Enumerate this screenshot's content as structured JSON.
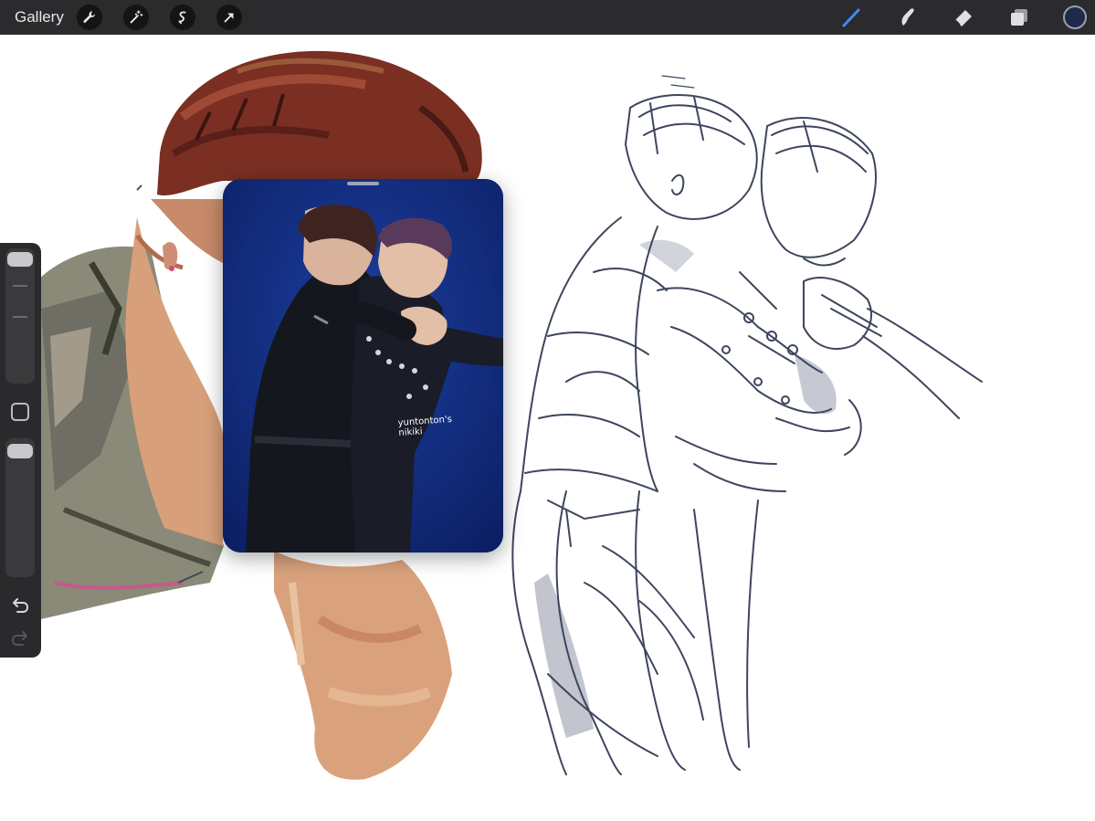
{
  "topbar": {
    "gallery_label": "Gallery",
    "left_tools": [
      {
        "name": "actions-wrench-icon"
      },
      {
        "name": "adjustments-wand-icon"
      },
      {
        "name": "selection-icon"
      },
      {
        "name": "transform-arrow-icon"
      }
    ],
    "right_tools": [
      {
        "name": "brush-icon",
        "active": true,
        "color": "#3d8bff"
      },
      {
        "name": "smudge-icon",
        "active": false
      },
      {
        "name": "eraser-icon",
        "active": false
      },
      {
        "name": "layers-icon",
        "active": false
      }
    ],
    "current_color": "#1f2a4a"
  },
  "sidebar": {
    "brush_size_level": 0.0,
    "opacity_level": 0.0
  },
  "reference": {
    "watermark": "yuntonton's\nnikiki",
    "background_color": "#102a7a"
  },
  "colors": {
    "toolbar_bg": "#2b2b2d",
    "sidebar_bg": "#2a2a2c",
    "sketch_ink": "#3e465e",
    "hair": "#7a2f22",
    "skin": "#d9a27c"
  }
}
